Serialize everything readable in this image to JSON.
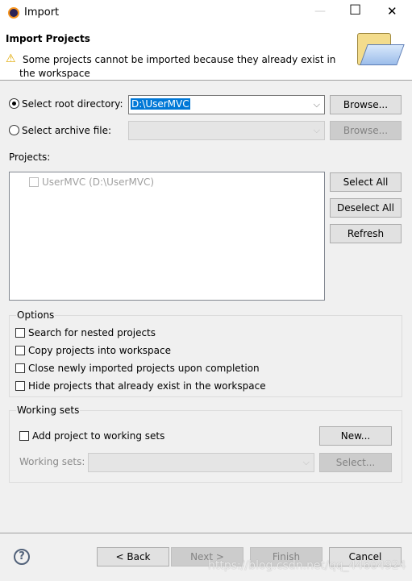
{
  "window": {
    "title": "Import",
    "minimize": "—",
    "maximize": "☐",
    "close": "✕"
  },
  "header": {
    "title": "Import Projects",
    "message": "Some projects cannot be imported because they already exist in the workspace"
  },
  "source": {
    "root_label": "Select root directory:",
    "root_value": "D:\\UserMVC",
    "root_browse": "Browse...",
    "archive_label": "Select archive file:",
    "archive_value": "",
    "archive_browse": "Browse..."
  },
  "projects": {
    "label": "Projects:",
    "items": [
      {
        "label": "UserMVC (D:\\UserMVC)",
        "checked": false,
        "disabled": true
      }
    ],
    "select_all": "Select All",
    "deselect_all": "Deselect All",
    "refresh": "Refresh"
  },
  "options": {
    "title": "Options",
    "items": [
      "Search for nested projects",
      "Copy projects into workspace",
      "Close newly imported projects upon completion",
      "Hide projects that already exist in the workspace"
    ]
  },
  "working_sets": {
    "title": "Working sets",
    "add_label": "Add project to working sets",
    "new": "New...",
    "sets_label": "Working sets:",
    "select": "Select..."
  },
  "footer": {
    "back": "< Back",
    "next": "Next >",
    "finish": "Finish",
    "cancel": "Cancel",
    "watermark": "https://blog.csdn.net/qq_44604924"
  }
}
